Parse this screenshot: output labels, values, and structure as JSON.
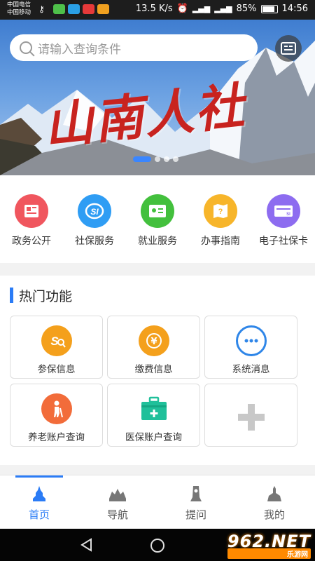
{
  "status_bar": {
    "carrier1": "中国电信",
    "carrier2": "中国移动",
    "speed": "13.5 K/s",
    "battery": "85%",
    "time": "14:56"
  },
  "search": {
    "placeholder": "请输入查询条件"
  },
  "banner": {
    "title": "山南人社",
    "slides": 4,
    "active_slide": 1
  },
  "quick_entries": [
    {
      "label": "政务公开",
      "icon": "newspaper-icon",
      "color": "#f0565e"
    },
    {
      "label": "社保服务",
      "icon": "si-badge-icon",
      "color": "#2f9df4"
    },
    {
      "label": "就业服务",
      "icon": "id-card-icon",
      "color": "#43c03d"
    },
    {
      "label": "办事指南",
      "icon": "map-guide-icon",
      "color": "#f7b52a"
    },
    {
      "label": "电子社保卡",
      "icon": "si-card-icon",
      "color": "#8d6cf0"
    }
  ],
  "hot_section": {
    "title": "热门功能",
    "items": [
      {
        "label": "参保信息",
        "icon": "si-search-icon",
        "color": "#f4a01c"
      },
      {
        "label": "缴费信息",
        "icon": "yuan-coin-icon",
        "color": "#f4a01c"
      },
      {
        "label": "系统消息",
        "icon": "chat-bubble-icon",
        "color": "#2f86e8"
      },
      {
        "label": "养老账户查询",
        "icon": "elderly-icon",
        "color": "#f26c3a"
      },
      {
        "label": "医保账户查询",
        "icon": "medical-kit-icon",
        "color": "#1fc09a"
      },
      {
        "label": "",
        "icon": "plus-icon",
        "color": "#c8c8c8"
      }
    ]
  },
  "tabs": [
    {
      "label": "首页",
      "icon": "home-stupa-icon",
      "active": true
    },
    {
      "label": "导航",
      "icon": "navigation-palace-icon",
      "active": false
    },
    {
      "label": "提问",
      "icon": "question-stele-icon",
      "active": false
    },
    {
      "label": "我的",
      "icon": "mine-temple-icon",
      "active": false
    }
  ],
  "watermark": {
    "big": "962.NET",
    "small": "乐游网"
  }
}
